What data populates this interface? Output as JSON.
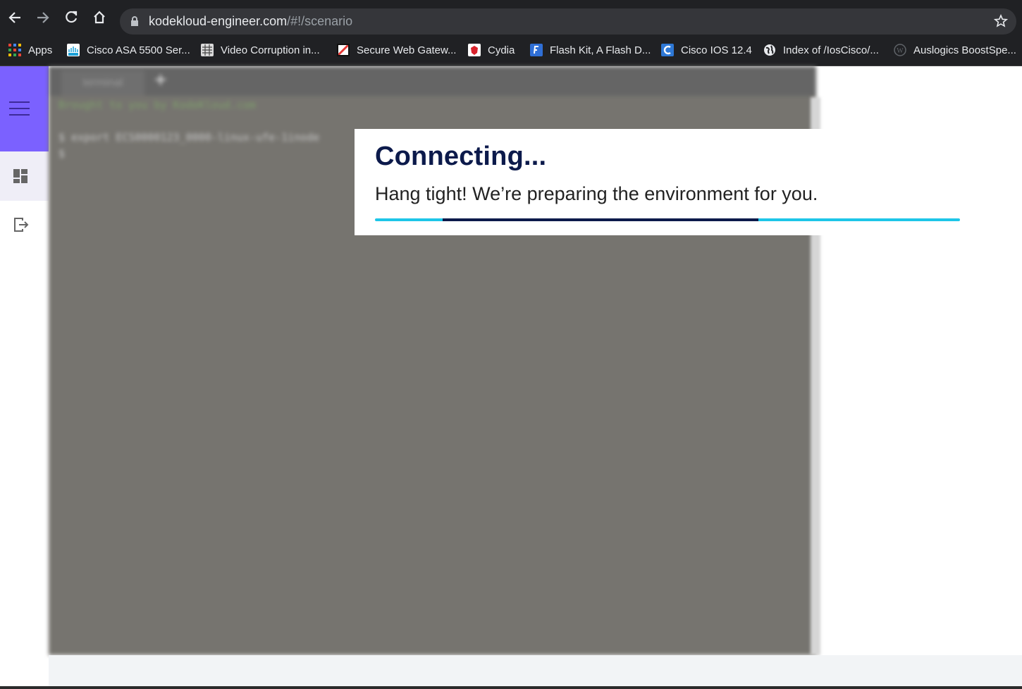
{
  "browser": {
    "url_host": "kodekloud-engineer.com",
    "url_path": "/#!/scenario",
    "bookmarks": [
      {
        "label": "Apps",
        "icon": "apps-grid-icon",
        "color": "#ea4335"
      },
      {
        "label": "Cisco ASA 5500 Ser...",
        "icon": "cisco-icon",
        "color": "#1ba0d7"
      },
      {
        "label": "Video Corruption in...",
        "icon": "grid-doc-icon",
        "color": "#cccccc"
      },
      {
        "label": "Secure Web Gatew...",
        "icon": "secure-gateway-icon",
        "color": "#ffffff"
      },
      {
        "label": "Cydia",
        "icon": "cydia-icon",
        "color": "#d9232d"
      },
      {
        "label": "Flash Kit, A Flash D...",
        "icon": "flashkit-icon",
        "color": "#2f6fd6"
      },
      {
        "label": "Cisco IOS 12.4",
        "icon": "cisco-ios-icon",
        "color": "#2e78d6"
      },
      {
        "label": "Index of /IosCisco/...",
        "icon": "globe-icon",
        "color": "#ffffff"
      },
      {
        "label": "Auslogics BoostSpe...",
        "icon": "wordpress-icon",
        "color": "#5f6368"
      }
    ]
  },
  "sidebar": {
    "accent": "#7b61ff",
    "items": [
      "menu-icon",
      "dashboard-icon",
      "logout-icon"
    ]
  },
  "terminal": {
    "tab_label": "terminal",
    "add_label": "+",
    "lines": [
      "Brought to you by KodeKloud.com",
      "$ export ECS0000123_0000-linux-ufe-1inode",
      "$"
    ]
  },
  "connecting": {
    "title": "Connecting...",
    "subtitle": "Hang tight! We’re preparing the environment for you.",
    "progress_start": 0.116,
    "progress_end": 0.656,
    "colors": {
      "track": "#1ec6e8",
      "fill": "#0c1a4b"
    }
  }
}
